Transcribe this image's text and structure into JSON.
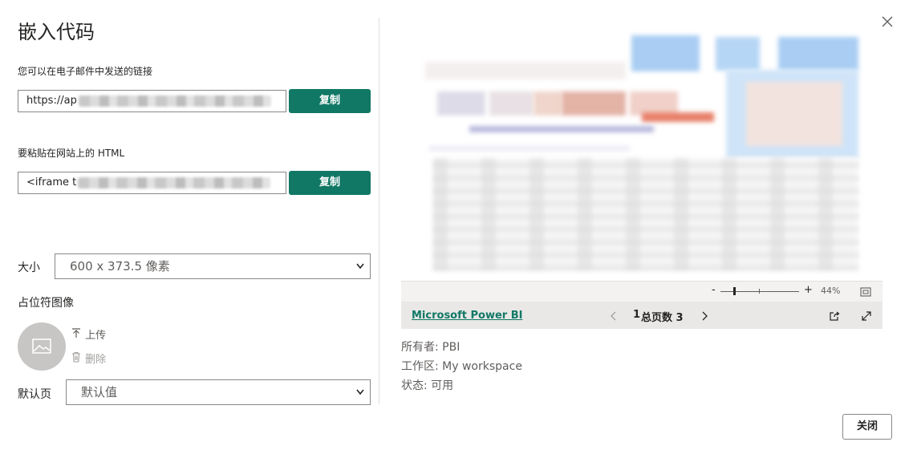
{
  "dialog": {
    "title": "嵌入代码",
    "close_label": "关闭",
    "close_icon": "×"
  },
  "link_section": {
    "label": "您可以在电子邮件中发送的链接",
    "value": "https://ap",
    "copy_label": "复制"
  },
  "html_section": {
    "label": "要粘贴在网站上的 HTML",
    "value": "<iframe t",
    "copy_label": "复制"
  },
  "size": {
    "label": "大小",
    "selected": "600 x 373.5 像素"
  },
  "placeholder_image": {
    "label": "占位符图像",
    "upload_label": "上传",
    "delete_label": "删除"
  },
  "default_page": {
    "label": "默认页",
    "selected": "默认值"
  },
  "preview": {
    "zoom_minus": "-",
    "zoom_plus": "+",
    "zoom_level": "44%",
    "zoom_level_value": 0.44,
    "brand_link": "Microsoft Power BI",
    "current_page": "1",
    "page_total_text": "总页数 3"
  },
  "info": {
    "owner": "所有者: PBI",
    "workspace": "工作区: My workspace",
    "status": "状态: 可用"
  },
  "colors": {
    "accent": "#117865",
    "link": "#117865"
  }
}
